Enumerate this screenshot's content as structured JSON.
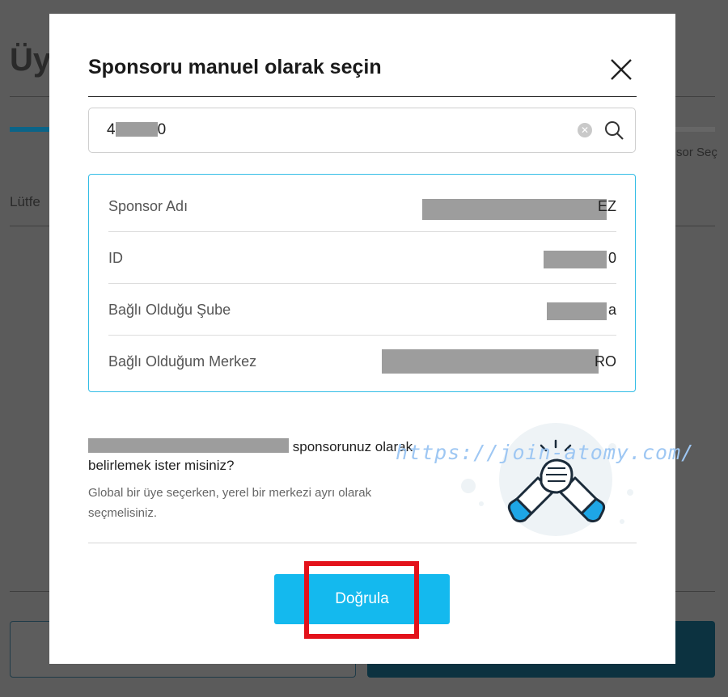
{
  "background": {
    "page_title": "Üy",
    "step_label": "sor Seç",
    "please_text": "Lütfe"
  },
  "modal": {
    "title": "Sponsoru manuel olarak seçin",
    "search": {
      "value": "4",
      "value_tail": "0"
    },
    "info_rows": [
      {
        "label": "Sponsor Adı",
        "value": "EZ"
      },
      {
        "label": "ID",
        "value": "0"
      },
      {
        "label": "Bağlı Olduğu Şube",
        "value": "a"
      },
      {
        "label": "Bağlı Olduğum Merkez",
        "value": "RO"
      }
    ],
    "confirm_text": "sponsorunuz olarak",
    "confirm_question": "belirlemek ister misiniz?",
    "hint": "Global bir üye seçerken, yerel bir merkezi ayrı olarak seçmelisiniz.",
    "watermark": "https://join-atomy.com/",
    "verify_label": "Doğrula"
  },
  "colors": {
    "accent": "#14b9ee",
    "info_border": "#33bde6",
    "highlight": "#e3121b"
  }
}
